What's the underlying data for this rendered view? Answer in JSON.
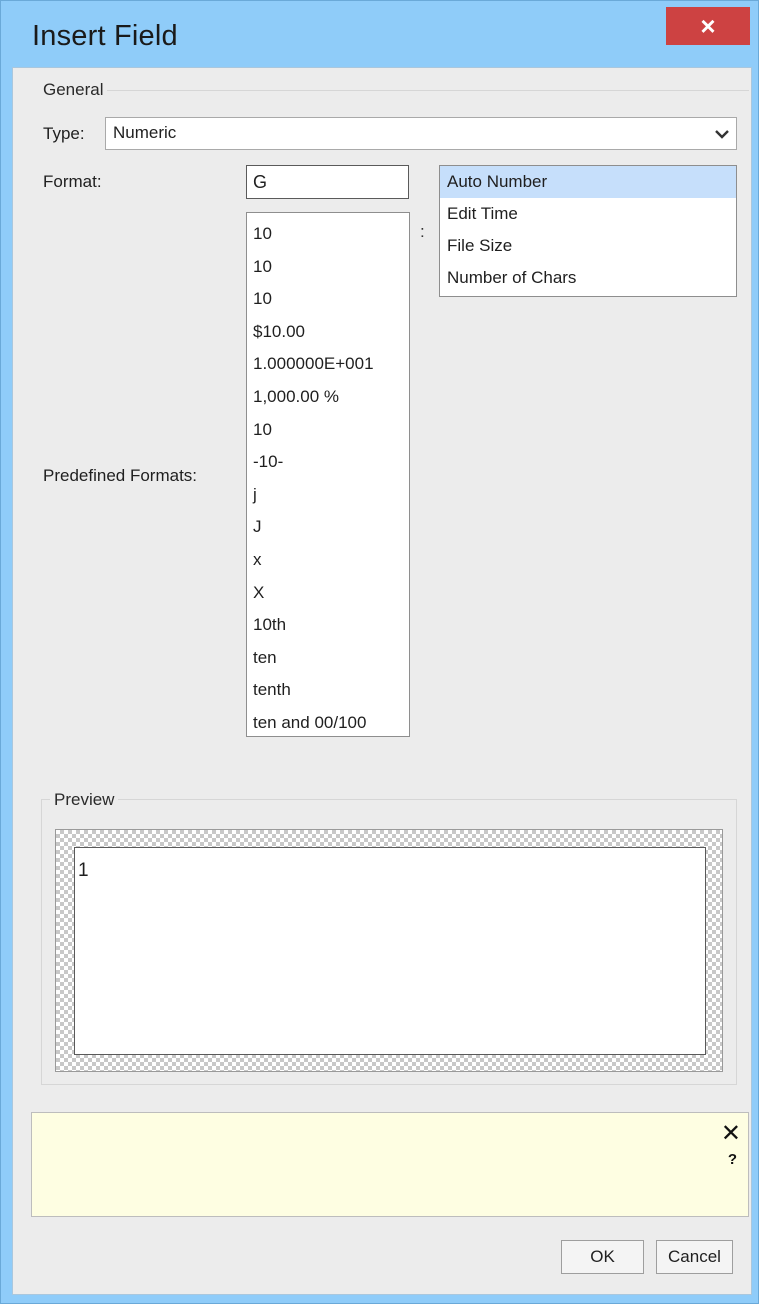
{
  "window": {
    "title": "Insert Field",
    "close_label": "×"
  },
  "general": {
    "legend": "General",
    "type_label": "Type:",
    "type_value": "Numeric",
    "format_label": "Format:",
    "format_value": "G",
    "predefined_label": "Predefined Formats:",
    "separator": ":",
    "predefined_formats": [
      "10",
      "10",
      "10",
      "$10.00",
      "1.000000E+001",
      "1,000.00 %",
      "10",
      "-10-",
      "j",
      "J",
      "x",
      "X",
      "10th",
      "ten",
      "tenth",
      "ten and 00/100"
    ],
    "fields": [
      "Auto Number",
      "Edit Time",
      "File Size",
      "Number of Chars"
    ],
    "selected_field": "Auto Number"
  },
  "preview": {
    "legend": "Preview",
    "value": "1"
  },
  "help": {
    "close_label": "✕",
    "help_label": "?"
  },
  "buttons": {
    "ok": "OK",
    "cancel": "Cancel"
  },
  "colors": {
    "title_bar": "#8fccf9",
    "close_button": "#cd4242",
    "selection": "#c6dffb",
    "help_background": "#fefee2"
  }
}
